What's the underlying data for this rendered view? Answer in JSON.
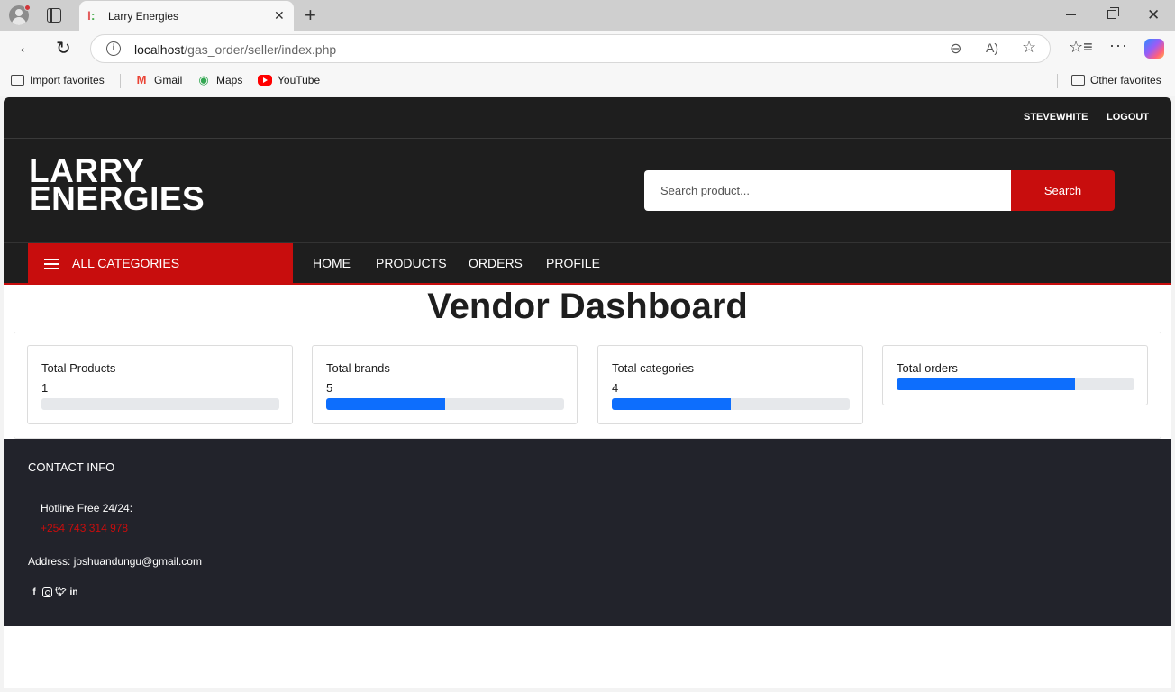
{
  "browser": {
    "tab_title": "Larry Energies",
    "url_host": "localhost",
    "url_path": "/gas_order/seller/index.php",
    "favorites": [
      {
        "label": "Import favorites",
        "icon": "import-icon"
      },
      {
        "label": "Gmail",
        "icon": "gmail-icon"
      },
      {
        "label": "Maps",
        "icon": "maps-icon"
      },
      {
        "label": "YouTube",
        "icon": "youtube-icon"
      }
    ],
    "other_favorites": "Other favorites"
  },
  "topbar": {
    "username": "STEVEWHITE",
    "logout": "LOGOUT"
  },
  "header": {
    "logo_line1": "LARRY",
    "logo_line2": "ENERGIES",
    "search_placeholder": "Search product...",
    "search_button": "Search"
  },
  "navbar": {
    "categories_label": "ALL CATEGORIES",
    "links": [
      "HOME",
      "PRODUCTS",
      "ORDERS",
      "PROFILE"
    ]
  },
  "dashboard": {
    "title": "Vendor Dashboard",
    "cards": [
      {
        "label": "Total Products",
        "value": "1",
        "progress_percent": 0
      },
      {
        "label": "Total brands",
        "value": "5",
        "progress_percent": 50
      },
      {
        "label": "Total categories",
        "value": "4",
        "progress_percent": 50
      },
      {
        "label": "Total orders",
        "value": "",
        "progress_percent": 75
      }
    ]
  },
  "footer": {
    "heading": "CONTACT INFO",
    "hotline_label": "Hotline Free 24/24:",
    "hotline_number": "+254 743 314 978",
    "address": "Address: joshuandungu@gmail.com",
    "social_icons": [
      "facebook-icon",
      "instagram-icon",
      "twitter-icon",
      "linkedin-icon"
    ]
  },
  "colors": {
    "brand_red": "#c80d0d",
    "dark_bg": "#1e1e1e",
    "footer_bg": "#22232b",
    "progress_blue": "#0d6efd"
  }
}
